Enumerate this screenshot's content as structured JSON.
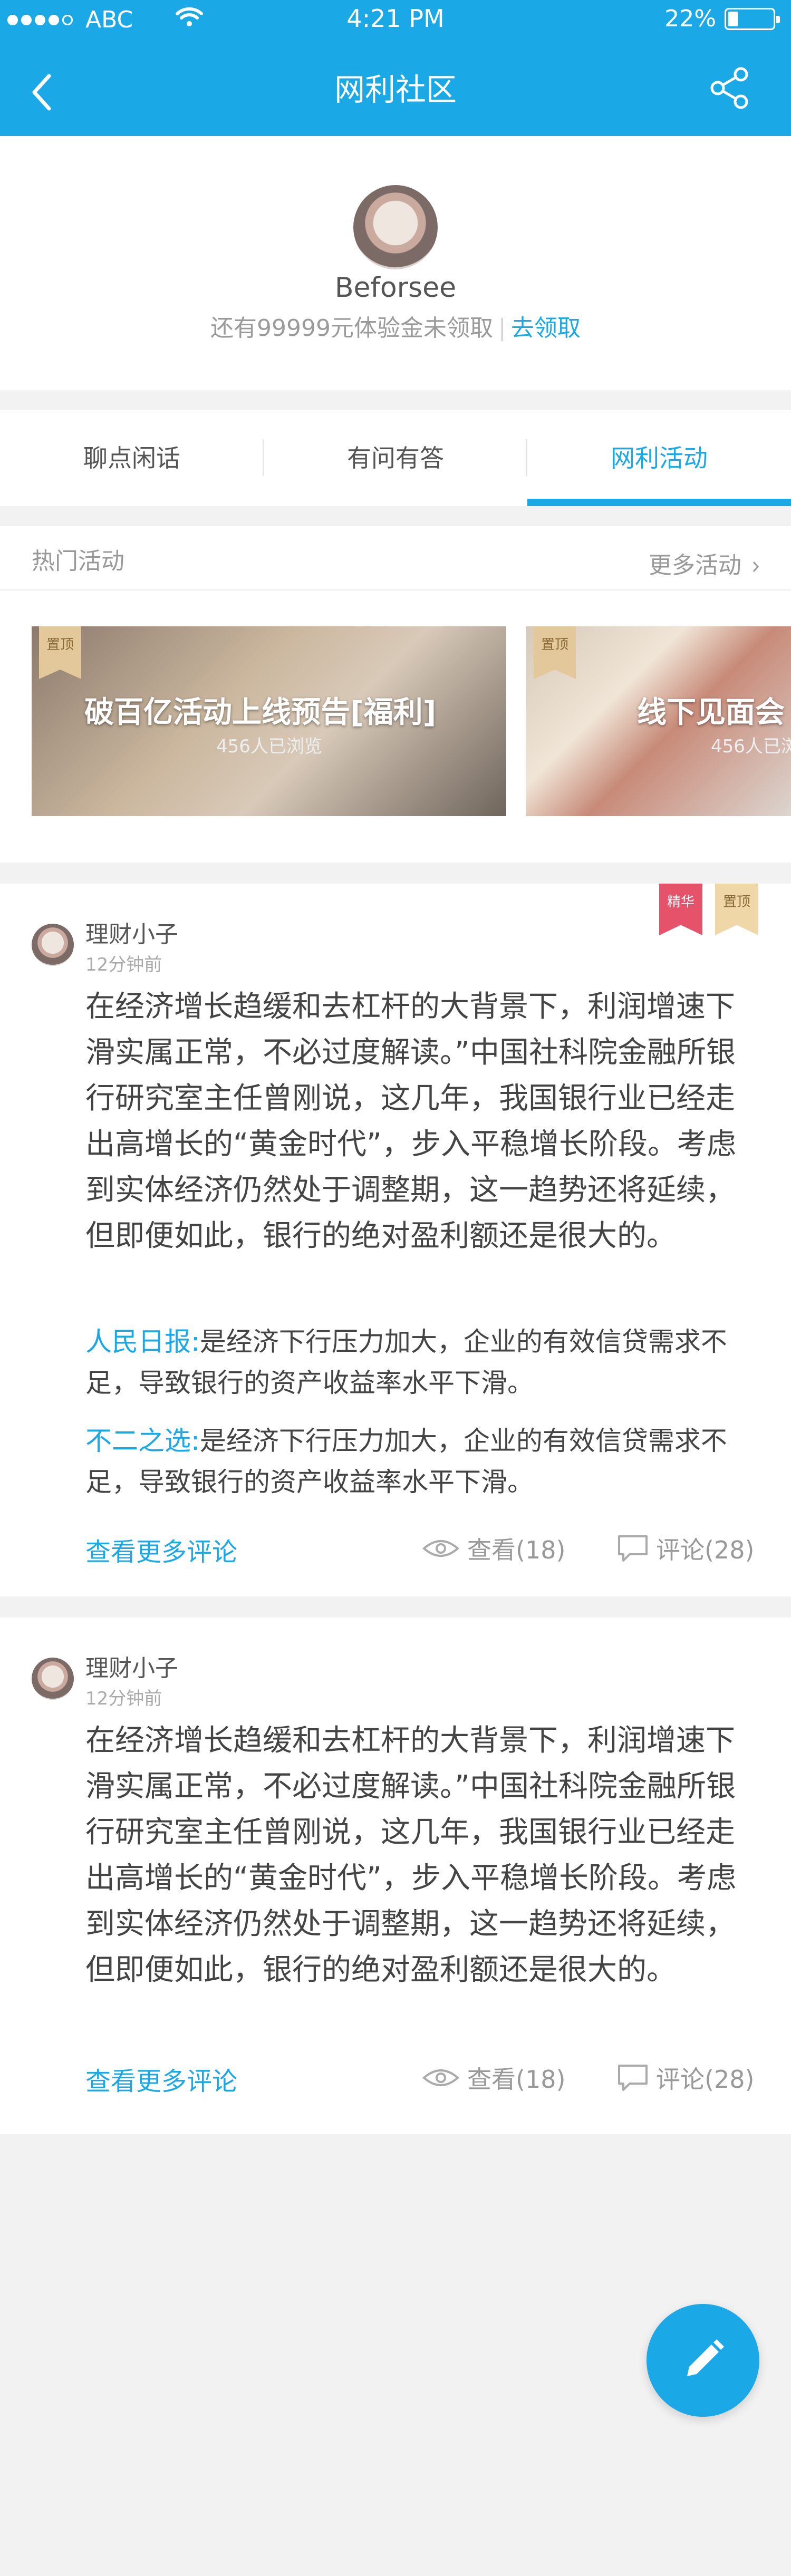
{
  "status_bar": {
    "carrier": "ABC",
    "time": "4:21 PM",
    "battery": "22%",
    "battery_level": 0.22
  },
  "nav": {
    "title": "网利社区"
  },
  "profile": {
    "name": "Beforsee",
    "trial_text": "还有99999元体验金未领取",
    "claim_link": "去领取"
  },
  "tabs": [
    {
      "label": "聊点闲话",
      "active": false
    },
    {
      "label": "有问有答",
      "active": false
    },
    {
      "label": "网利活动",
      "active": true
    }
  ],
  "hot": {
    "title": "热门活动",
    "more": "更多活动",
    "cards": [
      {
        "badge": "置顶",
        "title": "破百亿活动上线预告[福利]",
        "sub": "456人已浏览"
      },
      {
        "badge": "置顶",
        "title": "线下见面会",
        "sub": "456人已浏"
      }
    ]
  },
  "posts": [
    {
      "author": "理财小子",
      "time": "12分钟前",
      "badges": [
        "精华",
        "置顶"
      ],
      "body": "在经济增长趋缓和去杠杆的大背景下，利润增速下滑实属正常，不必过度解读。”中国社科院金融所银行研究室主任曾刚说，这几年，我国银行业已经走出高增长的“黄金时代”，步入平稳增长阶段。考虑到实体经济仍然处于调整期，这一趋势还将延续，但即便如此，银行的绝对盈利额还是很大的。",
      "comments": [
        {
          "author": "人民日报:",
          "text": "是经济下行压力加大，企业的有效信贷需求不足，导致银行的资产收益率水平下滑。"
        },
        {
          "author": "不二之选:",
          "text": "是经济下行压力加大，企业的有效信贷需求不足，导致银行的资产收益率水平下滑。"
        }
      ],
      "more_comments": "查看更多评论",
      "views": "查看(18)",
      "comments_count": "评论(28)"
    },
    {
      "author": "理财小子",
      "time": "12分钟前",
      "body": "在经济增长趋缓和去杠杆的大背景下，利润增速下滑实属正常，不必过度解读。”中国社科院金融所银行研究室主任曾刚说，这几年，我国银行业已经走出高增长的“黄金时代”，步入平稳增长阶段。考虑到实体经济仍然处于调整期，这一趋势还将延续，但即便如此，银行的绝对盈利额还是很大的。",
      "more_comments": "查看更多评论",
      "views": "查看(18)",
      "comments_count": "评论(28)"
    }
  ],
  "colors": {
    "accent": "#1ba8e6",
    "featured_badge": "#e6526a",
    "pinned_badge": "#efd7a8"
  },
  "icons": {
    "back": "chevron-left-icon",
    "share": "share-icon",
    "eye": "eye-icon",
    "comment": "comment-icon",
    "edit": "pencil-icon"
  }
}
